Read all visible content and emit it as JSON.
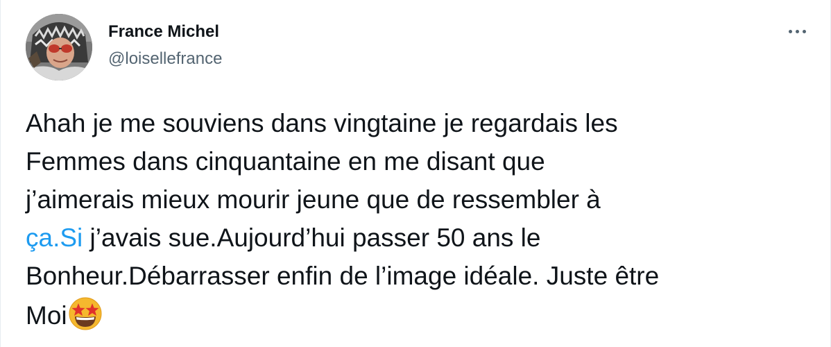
{
  "author": {
    "name": "France Michel",
    "handle": "@loisellefrance"
  },
  "menu": {
    "icon": "more-horizontal-icon"
  },
  "tweet": {
    "line1": "Ahah je me souviens dans vingtaine je regardais les",
    "line2": "Femmes dans cinquantaine en me disant que",
    "line3": "j’aimerais mieux mourir jeune que de ressembler à",
    "link_text": "ça.Si",
    "line4_rest": " j’avais sue.Aujourd’hui passer 50 ans le",
    "line5": "Bonheur.Débarrasser enfin de l’image idéale. Juste être",
    "line6": "Moi",
    "emoji": "star-struck-emoji"
  },
  "colors": {
    "text": "#0f1419",
    "secondary": "#536471",
    "link": "#1d9bf0"
  }
}
